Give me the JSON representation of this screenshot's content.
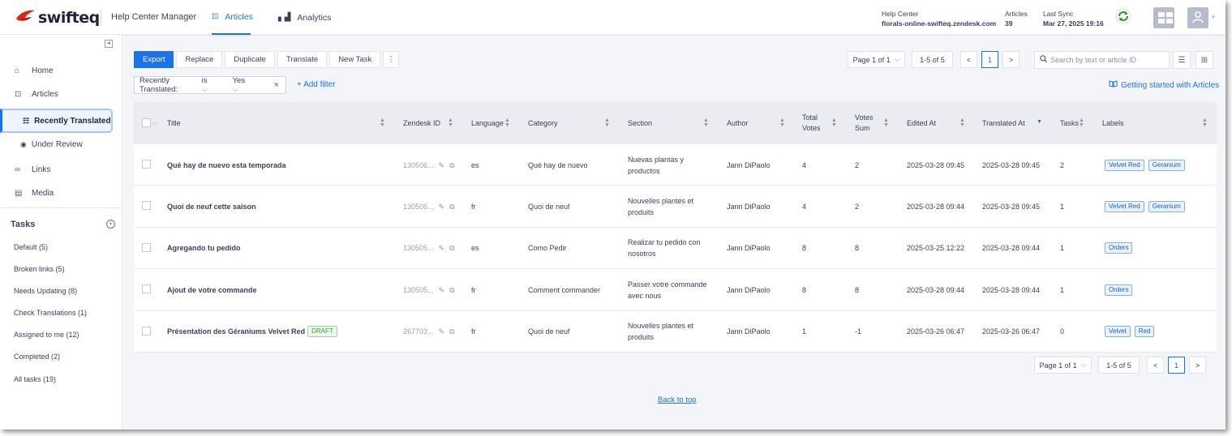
{
  "brand": {
    "logo_text": "swifteq",
    "app_title": "Help Center Manager"
  },
  "nav": {
    "articles_label": "Articles",
    "analytics_label": "Analytics"
  },
  "header": {
    "help_center_label": "Help Center",
    "help_center_value": "florals-online-swifteq.zendesk.com",
    "articles_label": "Articles",
    "articles_value": "39",
    "last_sync_label": "Last Sync",
    "last_sync_value": "Mar 27, 2025 19:16"
  },
  "sidebar": {
    "collapse_glyph": "◂",
    "home": "Home",
    "articles": "Articles",
    "recently_translated": "Recently Translated",
    "under_review": "Under Review",
    "links": "Links",
    "media": "Media",
    "tasks_title": "Tasks",
    "tasks_add": "+",
    "tasks": [
      "Default (5)",
      "Broken links (5)",
      "Needs Updating (8)",
      "Check Translations (1)",
      "Assigned to me (12)",
      "Completed (2)",
      "All tasks (19)"
    ]
  },
  "toolbar": {
    "export": "Export",
    "replace": "Replace",
    "duplicate": "Duplicate",
    "translate": "Translate",
    "new_task": "New Task",
    "more": "⋮"
  },
  "pagination": {
    "page_label": "Page 1 of 1",
    "caret": "⌵",
    "range": "1-5 of 5",
    "prev": "<",
    "current": "1",
    "next": ">"
  },
  "search": {
    "placeholder": "Search by text or article ID"
  },
  "filter": {
    "label": "Recently Translated:",
    "operator": "is",
    "value": "Yes",
    "caret": "⌵",
    "remove": "×",
    "add": "+ Add filter"
  },
  "getting_started": "Getting started with Articles",
  "table": {
    "columns": {
      "title": "Title",
      "zendesk_id": "Zendesk ID",
      "language": "Language",
      "category": "Category",
      "section": "Section",
      "author": "Author",
      "total_votes_1": "Total",
      "total_votes_2": "Votes",
      "votes_sum_1": "Votes",
      "votes_sum_2": "Sum",
      "edited_at": "Edited At",
      "translated_at": "Translated At",
      "tasks": "Tasks",
      "labels": "Labels"
    },
    "rows": [
      {
        "title": "Qué hay de nuevo esta temporada",
        "draft": "",
        "zendesk_id": "130506...",
        "language": "es",
        "category": "Qué hay de nuevo",
        "section_1": "Nuevas plantas y",
        "section_2": "productos",
        "author": "Jann DiPaolo",
        "total_votes": "4",
        "votes_sum": "2",
        "edited_at": "2025-03-28 09:45",
        "translated_at": "2025-03-28 09:45",
        "tasks": "2",
        "labels": [
          "Velvet Red",
          "Geranium"
        ]
      },
      {
        "title": "Quoi de neuf cette saison",
        "draft": "",
        "zendesk_id": "130506...",
        "language": "fr",
        "category": "Quoi de neuf",
        "section_1": "Nouvelles plantes et",
        "section_2": "produits",
        "author": "Jann DiPaolo",
        "total_votes": "4",
        "votes_sum": "2",
        "edited_at": "2025-03-28 09:44",
        "translated_at": "2025-03-28 09:45",
        "tasks": "1",
        "labels": [
          "Velvet Red",
          "Geranium"
        ]
      },
      {
        "title": "Agregando tu pedido",
        "draft": "",
        "zendesk_id": "130505...",
        "language": "es",
        "category": "Como Pedir",
        "section_1": "Realizar tu pedido con",
        "section_2": "nosotros",
        "author": "Jann DiPaolo",
        "total_votes": "8",
        "votes_sum": "8",
        "edited_at": "2025-03-25 12:22",
        "translated_at": "2025-03-28 09:44",
        "tasks": "1",
        "labels": [
          "Orders"
        ]
      },
      {
        "title": "Ajout de votre commande",
        "draft": "",
        "zendesk_id": "130505...",
        "language": "fr",
        "category": "Comment commander",
        "section_1": "Passer votre commande",
        "section_2": "avec nous",
        "author": "Jann DiPaolo",
        "total_votes": "8",
        "votes_sum": "8",
        "edited_at": "2025-03-28 09:44",
        "translated_at": "2025-03-28 09:44",
        "tasks": "1",
        "labels": [
          "Orders"
        ]
      },
      {
        "title": "Présentation des Géraniums Velvet Red",
        "draft": "DRAFT",
        "zendesk_id": "267703...",
        "language": "fr",
        "category": "Quoi de neuf",
        "section_1": "Nouvelles plantes et",
        "section_2": "produits",
        "author": "Jann DiPaolo",
        "total_votes": "1",
        "votes_sum": "-1",
        "edited_at": "2025-03-26 06:47",
        "translated_at": "2025-03-26 06:47",
        "tasks": "0",
        "labels": [
          "Velvet",
          "Red"
        ]
      }
    ]
  },
  "back_to_top": "Back to top",
  "colors": {
    "accent": "#1a73e8",
    "brand_red": "#e2231a",
    "sync_green": "#2e9a3a"
  }
}
